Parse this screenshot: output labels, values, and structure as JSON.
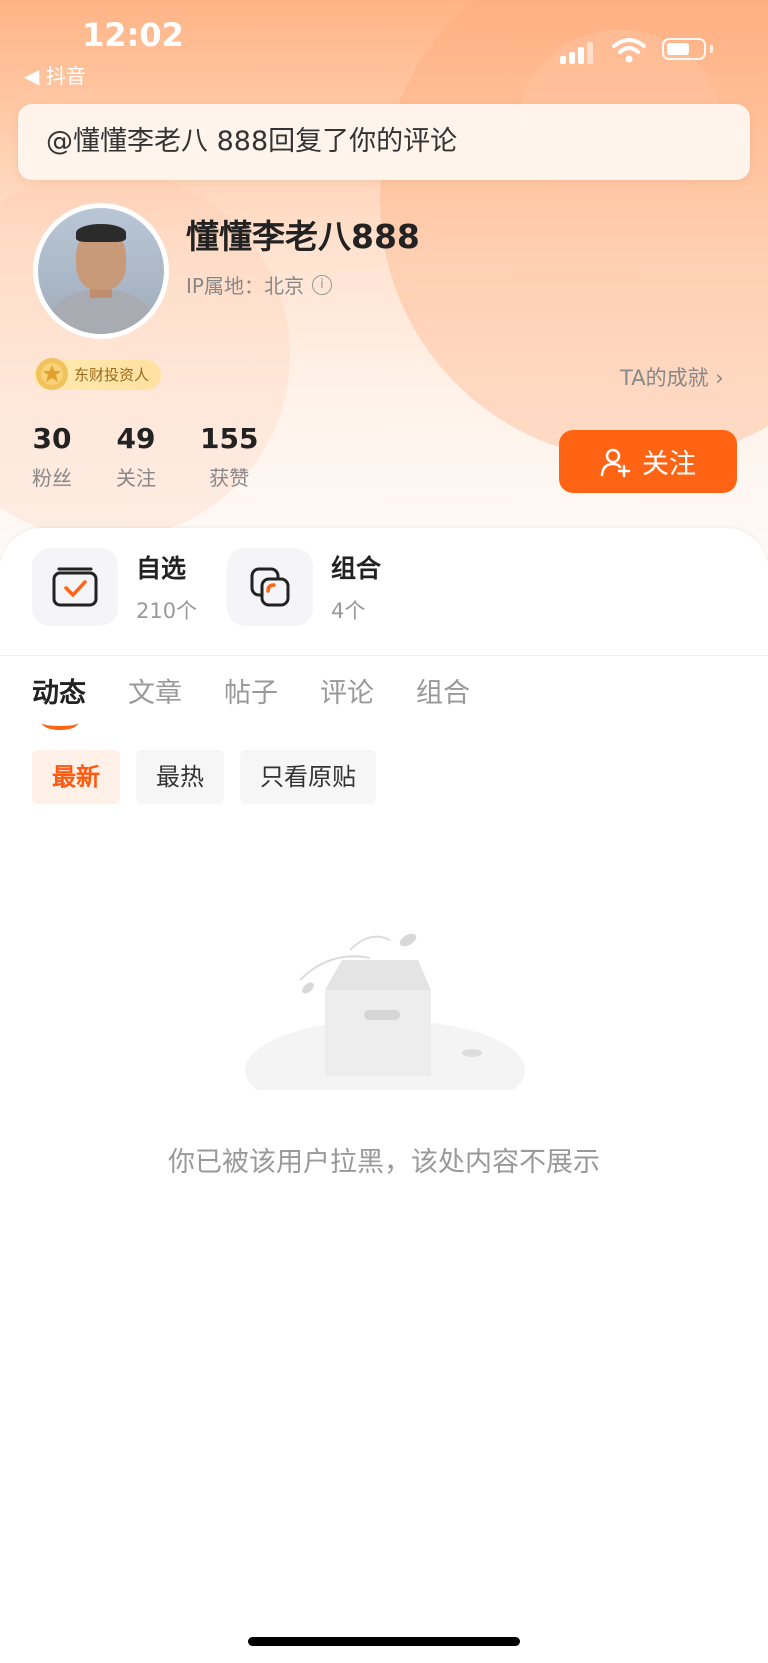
{
  "status_bar": {
    "time": "12:02",
    "back_app": "◀ 抖音"
  },
  "notification": {
    "text": "@懂懂李老八 888回复了你的评论"
  },
  "profile": {
    "username": "懂懂李老八888",
    "ip_location": "IP属地：北京",
    "badge": "东财投资人",
    "achievements_link": "TA的成就 ›",
    "stats": [
      {
        "value": "30",
        "label": "粉丝"
      },
      {
        "value": "49",
        "label": "关注"
      },
      {
        "value": "155",
        "label": "获赞"
      }
    ],
    "follow_button": "关注"
  },
  "quick_entries": [
    {
      "title": "自选",
      "sub": "210个",
      "icon": "watchlist-icon"
    },
    {
      "title": "组合",
      "sub": "4个",
      "icon": "portfolio-icon"
    }
  ],
  "tabs": [
    "动态",
    "文章",
    "帖子",
    "评论",
    "组合"
  ],
  "active_tab": "动态",
  "filters": [
    "最新",
    "最热",
    "只看原贴"
  ],
  "active_filter": "最新",
  "empty_state": {
    "message": "你已被该用户拉黑，该处内容不展示",
    "icon": "empty-box-illustration"
  },
  "colors": {
    "accent": "#ff6414",
    "hero_top": "#ffb486",
    "text_primary": "#222222",
    "text_secondary": "#999999"
  }
}
